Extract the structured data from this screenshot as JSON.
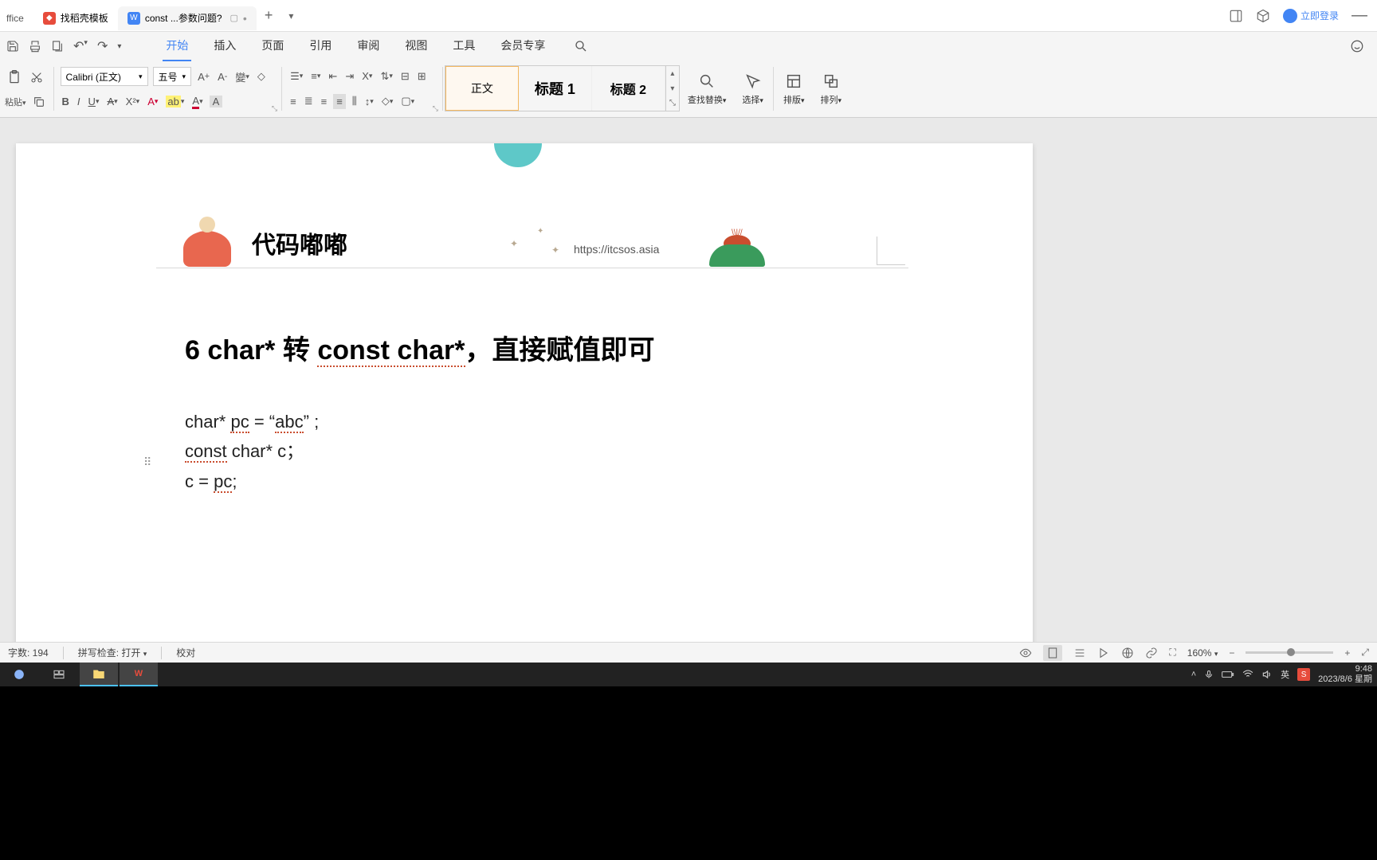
{
  "tabs": {
    "office": "ffice",
    "template": "找稻壳模板",
    "active": "const ...参数问题?"
  },
  "titlebar": {
    "login": "立即登录"
  },
  "menu": {
    "start": "开始",
    "insert": "插入",
    "page": "页面",
    "ref": "引用",
    "review": "审阅",
    "view": "视图",
    "tools": "工具",
    "member": "会员专享"
  },
  "ribbon": {
    "paste": "粘贴",
    "font_name": "Calibri (正文)",
    "font_size": "五号",
    "style_normal": "正文",
    "style_h1": "标题 1",
    "style_h2": "标题 2",
    "find": "查找替换",
    "select": "选择",
    "layout": "排版",
    "arrange": "排列"
  },
  "document": {
    "header_brand": "代码嘟嘟",
    "header_url": "https://itcsos.asia",
    "heading_p1": "6 char* 转 ",
    "heading_ul": "const char*",
    "heading_p2": "，直接赋值即可",
    "line1_a": "char* ",
    "line1_ul": "pc",
    "line1_b": " = “",
    "line1_ul2": "abc",
    "line1_c": "” ;",
    "line2_ul": "const",
    "line2_b": " char* c；",
    "line3_a": "c = ",
    "line3_ul": "pc",
    "line3_b": ";"
  },
  "status": {
    "words": "字数: 194",
    "spell": "拼写检查: 打开",
    "proof": "校对",
    "zoom": "160%"
  },
  "taskbar": {
    "ime": "英",
    "time": "9:48",
    "date": "2023/8/6 星期"
  }
}
